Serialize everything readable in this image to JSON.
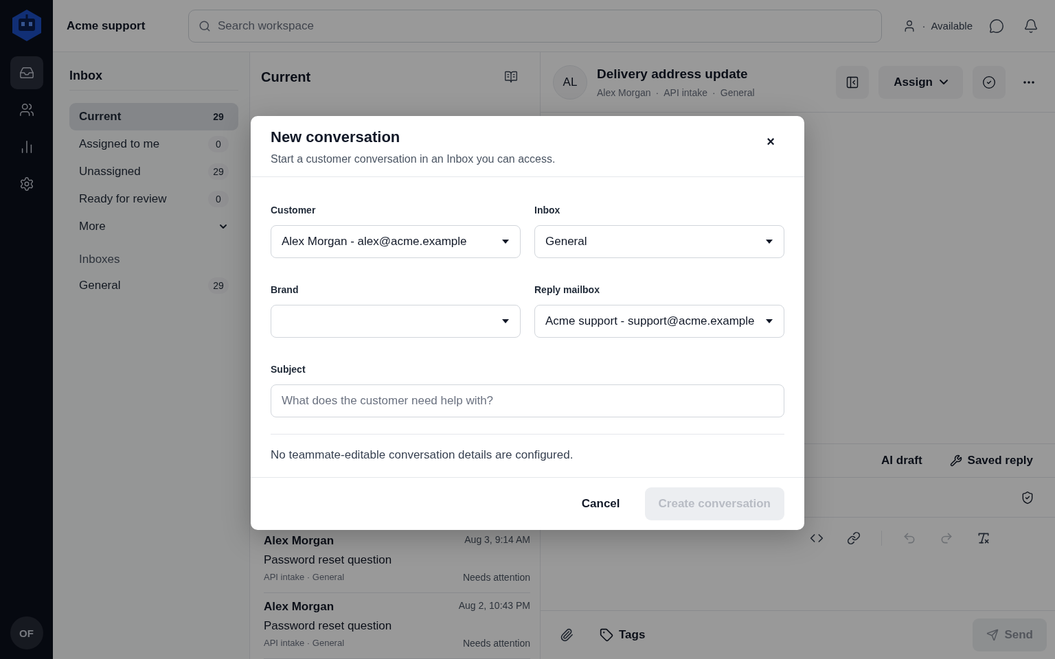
{
  "rail": {
    "items": [
      {
        "kind": "inbox",
        "selected": true
      },
      {
        "kind": "people",
        "selected": false
      },
      {
        "kind": "reports",
        "selected": false
      },
      {
        "kind": "settings",
        "selected": false
      }
    ],
    "avatar": "OF"
  },
  "header": {
    "workspace": "Acme support",
    "search": {
      "placeholder": "Search workspace"
    },
    "status_separator": "·",
    "status": "Available"
  },
  "sidebar": {
    "title": "Inbox",
    "views": [
      {
        "label": "Current",
        "count": "29",
        "selected": true
      },
      {
        "label": "Assigned to me",
        "count": "0",
        "selected": false
      },
      {
        "label": "Unassigned",
        "count": "29",
        "selected": false
      },
      {
        "label": "Ready for review",
        "count": "0",
        "selected": false
      }
    ],
    "more": "More",
    "inboxes_heading": "Inboxes",
    "inboxes": [
      {
        "label": "General",
        "count": "29",
        "selected": false
      }
    ]
  },
  "list": {
    "title": "Current",
    "rows": [
      {
        "name": "Alex Morgan",
        "time": "Aug 3, 9:14 AM",
        "subject": "Password reset question",
        "meta": "API intake · General",
        "status": "Needs attention"
      },
      {
        "name": "Alex Morgan",
        "time": "Aug 2, 10:43 PM",
        "subject": "Password reset question",
        "meta": "API intake · General",
        "status": "Needs attention"
      }
    ]
  },
  "detail": {
    "avatar": "AL",
    "title": "Delivery address update",
    "meta": [
      "Alex Morgan",
      "API intake",
      "General"
    ],
    "meta_separator": "·",
    "assign": "Assign",
    "composer_tabs": [
      "AI draft",
      "Saved reply"
    ],
    "tags": "Tags",
    "send": {
      "label": "Send",
      "disabled": true
    }
  },
  "dialog": {
    "title": "New conversation",
    "subtitle": "Start a customer conversation in an Inbox you can access.",
    "close": "×",
    "fields": [
      {
        "label": "Customer",
        "value": "Alex Morgan - alex@acme.example"
      },
      {
        "label": "Inbox",
        "value": "General"
      },
      {
        "label": "Brand"
      },
      {
        "label": "Reply mailbox",
        "value": "Acme support - support@acme.example"
      }
    ],
    "subject": {
      "label": "Subject",
      "placeholder": "What does the customer need help with?"
    },
    "note": "No teammate-editable conversation details are configured.",
    "cancel": "Cancel",
    "create": {
      "label": "Create conversation",
      "disabled": true
    }
  }
}
